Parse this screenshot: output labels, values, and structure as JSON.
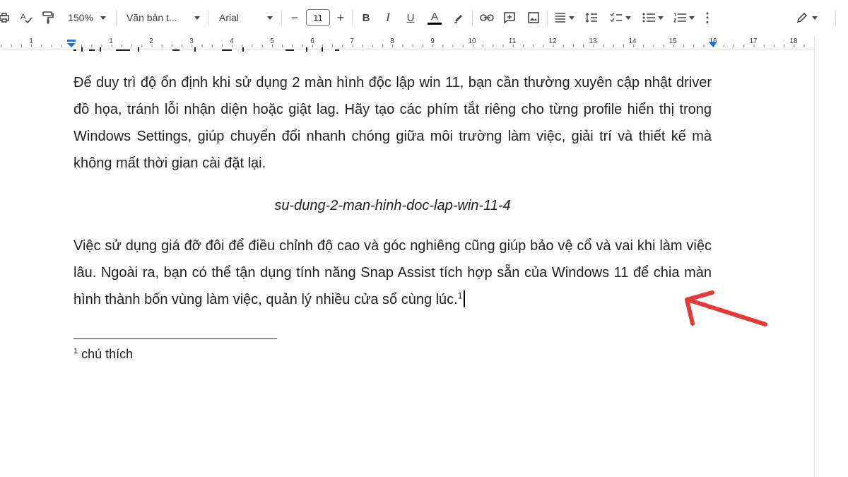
{
  "toolbar": {
    "zoom": "150%",
    "style": "Văn bản t...",
    "font": "Arial",
    "font_size": "11",
    "minus": "−",
    "plus": "+",
    "bold": "B",
    "italic": "I",
    "underline": "U",
    "text_color": "A",
    "more": "⋮"
  },
  "ruler": {
    "numbers": [
      "1",
      "1",
      "2",
      "3",
      "4",
      "5",
      "6",
      "7",
      "8",
      "9",
      "10",
      "11",
      "12",
      "13",
      "14",
      "15",
      "16",
      "17",
      "18"
    ]
  },
  "document": {
    "paragraph1": "Để duy trì độ ổn định khi sử dụng 2 màn hình độc lập win 11, bạn cần thường xuyên cập nhật driver đồ họa, tránh lỗi nhận diện hoặc giật lag. Hãy tạo các phím tắt riêng cho từng profile hiển thị trong Windows Settings, giúp chuyển đổi nhanh chóng giữa môi trường làm việc, giải trí và thiết kế mà không mất thời gian cài đặt lại.",
    "image_caption": "su-dung-2-man-hinh-doc-lap-win-11-4",
    "paragraph2": "Việc sử dụng giá đỡ đôi để điều chỉnh độ cao và góc nghiêng cũng giúp bảo vệ cổ và vai khi làm việc lâu. Ngoài ra, bạn có thể tận dụng tính năng Snap Assist tích hợp sẵn của Windows 11 để chia màn hình thành bốn vùng làm việc, quản lý nhiều cửa sổ cùng lúc.",
    "footnote_ref": "1",
    "footnote_number": "1",
    "footnote_text": "chú thích"
  },
  "colors": {
    "arrow": "#e53935",
    "ruler_marker": "#1a73e8"
  }
}
